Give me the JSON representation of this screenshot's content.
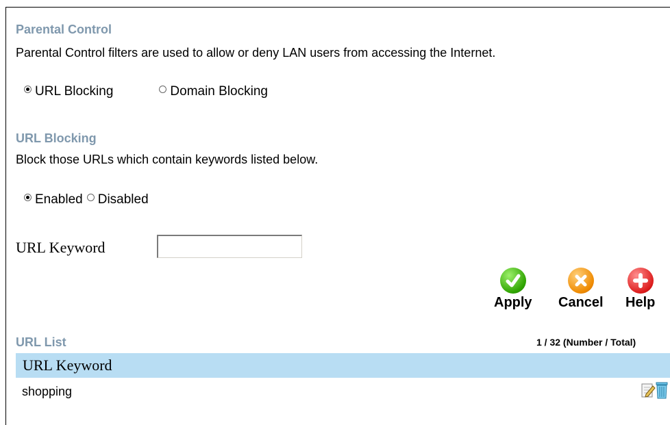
{
  "parental_control": {
    "title": "Parental Control",
    "description": "Parental Control filters are used to allow or deny LAN users from accessing the Internet.",
    "options": [
      {
        "label": "URL Blocking",
        "checked": true
      },
      {
        "label": "Domain Blocking",
        "checked": false
      }
    ]
  },
  "url_blocking": {
    "title": "URL Blocking",
    "description": "Block those URLs which contain keywords listed below.",
    "state_options": [
      {
        "label": "Enabled",
        "checked": true
      },
      {
        "label": "Disabled",
        "checked": false
      }
    ],
    "keyword_label": "URL Keyword",
    "keyword_value": ""
  },
  "actions": {
    "apply": "Apply",
    "cancel": "Cancel",
    "help": "Help"
  },
  "url_list": {
    "title": "URL List",
    "count": "1 / 32 (Number / Total)",
    "header": "URL Keyword",
    "rows": [
      {
        "keyword": "shopping"
      }
    ]
  },
  "icons": {
    "apply": "check-icon",
    "cancel": "x-icon",
    "help": "plus-icon",
    "edit": "edit-icon",
    "delete": "trash-icon"
  },
  "colors": {
    "section_title": "#7f98ad",
    "list_header_bg": "#b8ddf3"
  }
}
